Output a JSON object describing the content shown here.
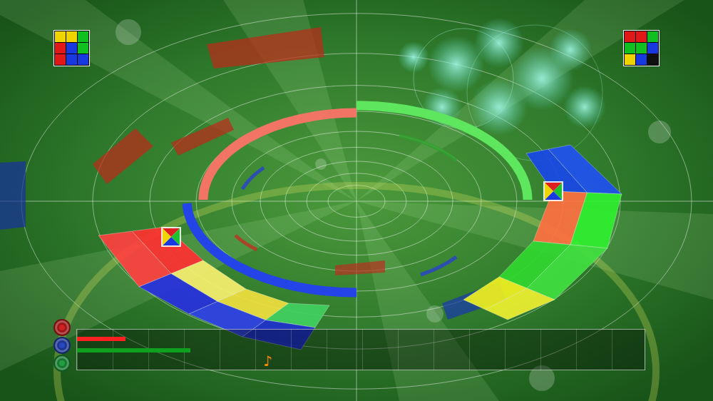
{
  "preview_grids": [
    {
      "cells": [
        {
          "color": "#f0d400"
        },
        {
          "color": "#f0d400"
        },
        {
          "color": "#10c020"
        },
        {
          "color": "#e01818"
        },
        {
          "color": "#1838e0"
        },
        {
          "color": "#10c020"
        },
        {
          "color": "#e01818"
        },
        {
          "color": "#1838e0"
        },
        {
          "color": "#1838e0"
        }
      ]
    },
    {
      "cells": [
        {
          "color": "#e01818"
        },
        {
          "color": "#e01818"
        },
        {
          "color": "#10c020"
        },
        {
          "color": "#10c020"
        },
        {
          "color": "#10c020"
        },
        {
          "color": "#1838e0"
        },
        {
          "color": "#f0d400"
        },
        {
          "color": "#1838e0"
        },
        {
          "color": "#101010"
        }
      ]
    }
  ],
  "rings": [
    {
      "color": "#f27464"
    },
    {
      "color": "#5ee65e"
    },
    {
      "color": "#2444e8"
    }
  ],
  "ribbons": [
    {
      "inner": [
        {
          "color": "#ff3030"
        },
        {
          "color": "#f8f070"
        },
        {
          "color": "#f0e040"
        },
        {
          "color": "#40d060"
        }
      ],
      "outer": [
        {
          "color": "#ff4040"
        },
        {
          "color": "#2830e0"
        },
        {
          "color": "#3040e8"
        },
        {
          "color": "#2030d0"
        }
      ]
    },
    {
      "inner": [
        {
          "color": "#1848e8"
        },
        {
          "color": "#ff7040"
        },
        {
          "color": "#30d830"
        },
        {
          "color": "#f0f020"
        }
      ],
      "outer": [
        {
          "color": "#2050f0"
        },
        {
          "color": "#30f030"
        },
        {
          "color": "#40e040"
        },
        {
          "color": "#f0f030"
        }
      ]
    }
  ],
  "floating_blocks": [
    {
      "color": "#c02818"
    },
    {
      "color": "#c02818"
    },
    {
      "color": "#c02818"
    },
    {
      "color": "#b83020"
    },
    {
      "color": "#1830a0"
    },
    {
      "color": "#1838b0"
    }
  ],
  "meters": [
    {
      "icon_color": "#d02020",
      "bar_color": "#ff2020",
      "level": 0.085
    },
    {
      "icon_color": "#2848c0",
      "bar_color": "#10a020",
      "level": 0.2
    },
    {
      "icon_color": "#20a040",
      "bar_color": "#20a040",
      "level": 0
    }
  ],
  "marker": {
    "text": "♪",
    "level": 0.336
  }
}
